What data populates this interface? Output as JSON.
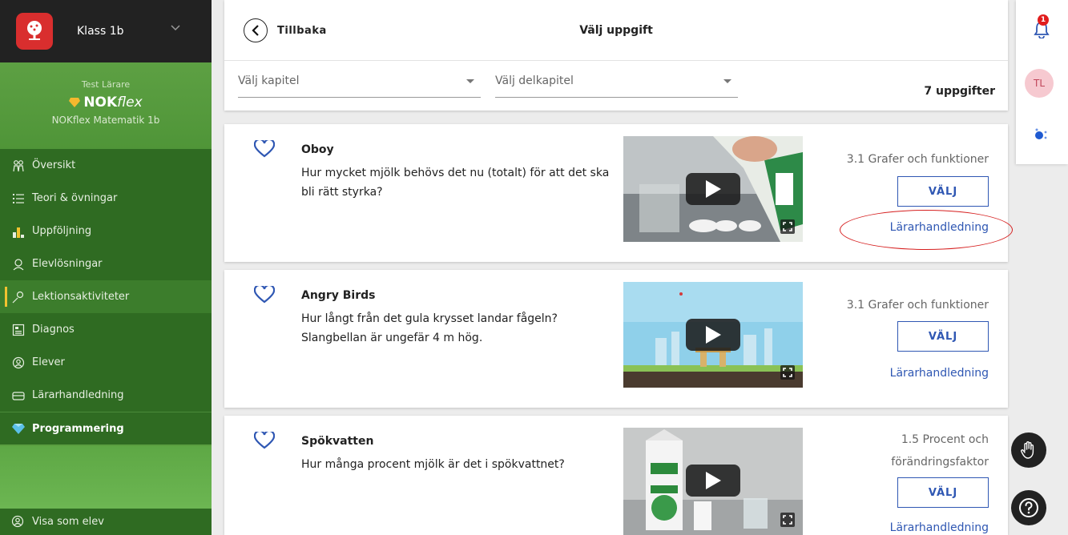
{
  "sidebar": {
    "class_name": "Klass 1b",
    "teacher": "Test Lärare",
    "brand_bold": "NOK",
    "brand_italic": "flex",
    "book": "NOKflex Matematik 1b",
    "items": [
      {
        "label": "Översikt",
        "icon": "family-icon"
      },
      {
        "label": "Teori & övningar",
        "icon": "list-icon"
      },
      {
        "label": "Uppföljning",
        "icon": "bar-chart-icon"
      },
      {
        "label": "Elevlösningar",
        "icon": "student-solutions-icon"
      },
      {
        "label": "Lektionsaktiviteter",
        "icon": "lesson-activity-icon"
      },
      {
        "label": "Diagnos",
        "icon": "diagnosis-icon"
      },
      {
        "label": "Elever",
        "icon": "user-icon"
      },
      {
        "label": "Lärarhandledning",
        "icon": "guide-icon"
      },
      {
        "label": "Programmering",
        "icon": "diamond-icon"
      }
    ],
    "bottom_item": "Visa som elev"
  },
  "header": {
    "back_label": "Tillbaka",
    "title": "Välj uppgift",
    "chapter_placeholder": "Välj kapitel",
    "subchapter_placeholder": "Välj delkapitel",
    "count": "7 uppgifter"
  },
  "tasks": [
    {
      "title": "Oboy",
      "description": "Hur mycket mjölk behövs det nu (totalt) för att det ska bli rätt styrka?",
      "category": "3.1 Grafer och funktioner",
      "select_label": "VÄLJ",
      "guide_label": "Lärarhandledning"
    },
    {
      "title": "Angry Birds",
      "description": "Hur långt från det gula krysset landar fågeln? Slangbellan är ungefär 4 m hög.",
      "category": "3.1 Grafer och funktioner",
      "select_label": "VÄLJ",
      "guide_label": "Lärarhandledning"
    },
    {
      "title": "Spökvatten",
      "description": "Hur många procent mjölk är det i spökvattnet?",
      "category_line1": "1.5 Procent och",
      "category_line2": "förändringsfaktor",
      "select_label": "VÄLJ",
      "guide_label": "Lärarhandledning"
    }
  ],
  "rail": {
    "notification_count": "1",
    "avatar_initials": "TL"
  },
  "colors": {
    "sidebar_green": "#5a9e3f",
    "nav_dark_green": "#2f6b22",
    "link_blue": "#2f57b3",
    "highlight_red": "#d62020"
  }
}
